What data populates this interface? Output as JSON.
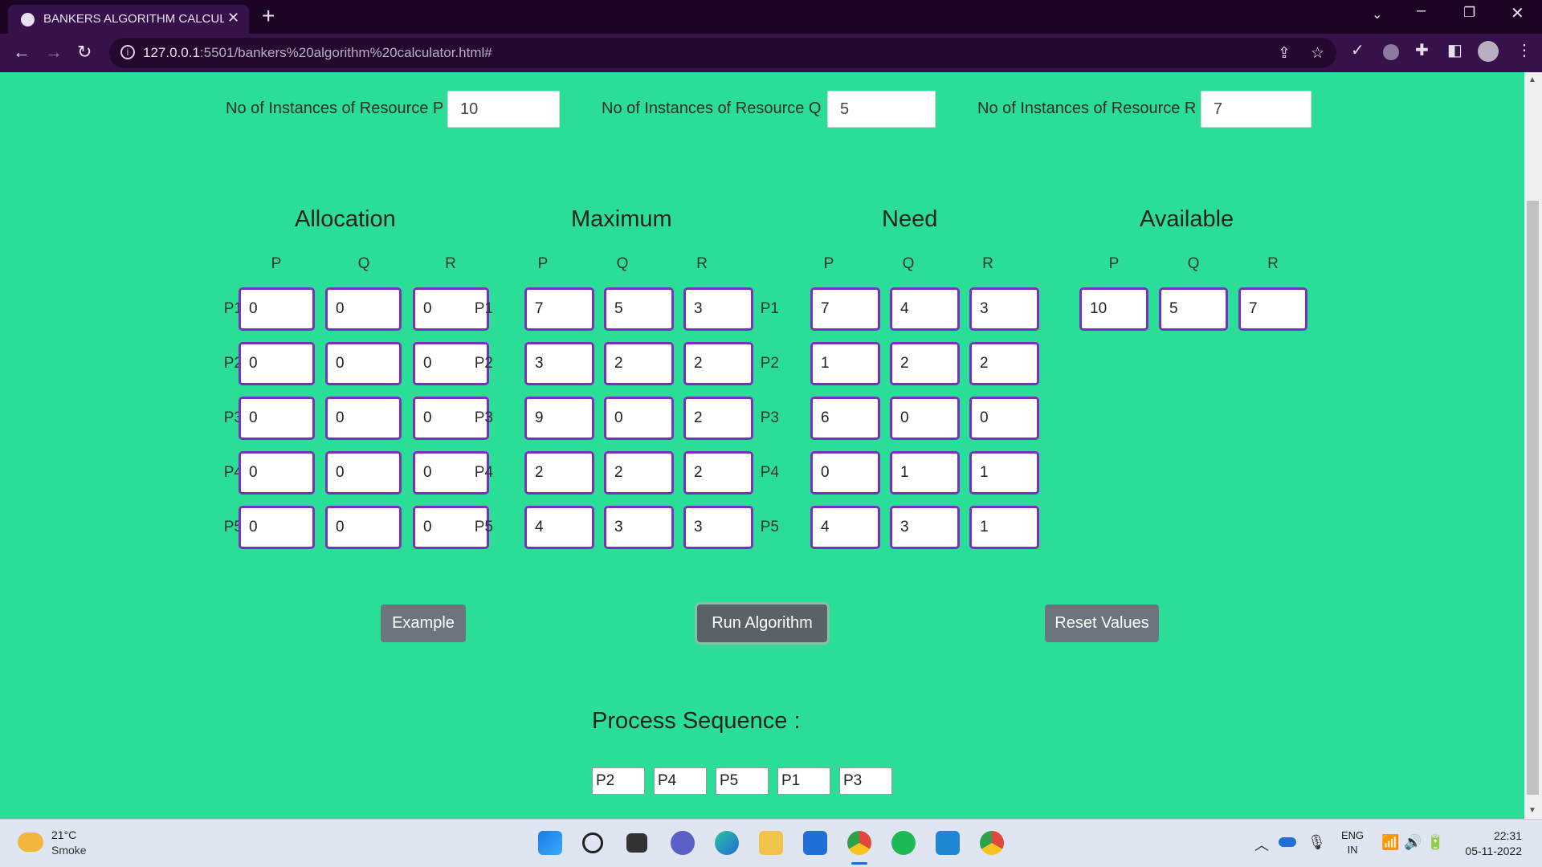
{
  "browser": {
    "tab_title": "BANKERS ALGORITHM CALCULATOR",
    "url_host": "127.0.0.1",
    "url_rest": ":5501/bankers%20algorithm%20calculator.html#"
  },
  "resources": [
    {
      "label": "No of Instances of Resource P",
      "value": "10"
    },
    {
      "label": "No of Instances of Resource Q",
      "value": "5"
    },
    {
      "label": "No of Instances of Resource R",
      "value": "7"
    }
  ],
  "sections": {
    "allocation": "Allocation",
    "maximum": "Maximum",
    "need": "Need",
    "available": "Available"
  },
  "columns": [
    "P",
    "Q",
    "R"
  ],
  "processes": [
    "P1",
    "P2",
    "P3",
    "P4",
    "P5"
  ],
  "allocation": [
    [
      "0",
      "0",
      "0"
    ],
    [
      "0",
      "0",
      "0"
    ],
    [
      "0",
      "0",
      "0"
    ],
    [
      "0",
      "0",
      "0"
    ],
    [
      "0",
      "0",
      "0"
    ]
  ],
  "maximum": [
    [
      "7",
      "5",
      "3"
    ],
    [
      "3",
      "2",
      "2"
    ],
    [
      "9",
      "0",
      "2"
    ],
    [
      "2",
      "2",
      "2"
    ],
    [
      "4",
      "3",
      "3"
    ]
  ],
  "need": [
    [
      "7",
      "4",
      "3"
    ],
    [
      "1",
      "2",
      "2"
    ],
    [
      "6",
      "0",
      "0"
    ],
    [
      "0",
      "1",
      "1"
    ],
    [
      "4",
      "3",
      "1"
    ]
  ],
  "available": [
    "10",
    "5",
    "7"
  ],
  "buttons": {
    "example": "Example",
    "run": "Run Algorithm",
    "reset": "Reset Values"
  },
  "sequence": {
    "title": "Process Sequence :",
    "values": [
      "P2",
      "P4",
      "P5",
      "P1",
      "P3"
    ]
  },
  "taskbar": {
    "temperature": "21°C",
    "weather": "Smoke",
    "lang_top": "ENG",
    "lang_bottom": "IN",
    "time": "22:31",
    "date": "05-11-2022"
  }
}
